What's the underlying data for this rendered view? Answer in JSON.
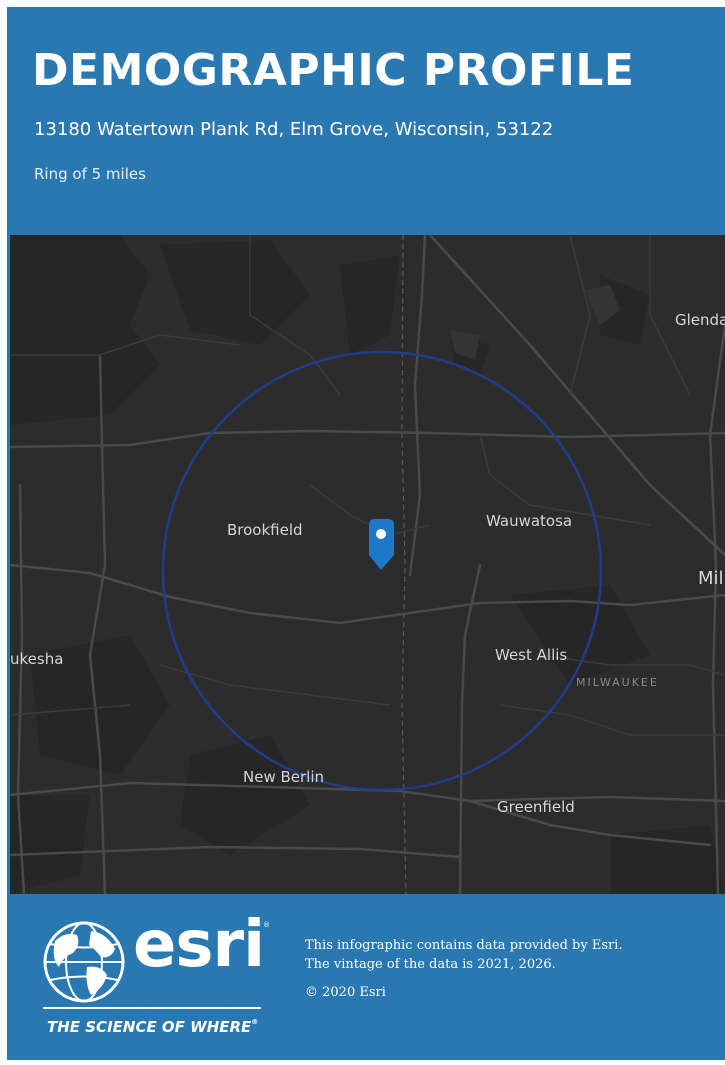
{
  "header": {
    "title": "DEMOGRAPHIC PROFILE",
    "address": "13180 Watertown Plank Rd, Elm Grove, Wisconsin, 53122",
    "ring": "Ring of 5 miles"
  },
  "map": {
    "labels": {
      "glendale": "Glendal",
      "brookfield": "Brookfield",
      "wauwatosa": "Wauwatosa",
      "milwaukee_city": "Mil",
      "waukesha": "ukesha",
      "west_allis": "West Allis",
      "milwaukee_county": "MILWAUKEE",
      "new_berlin": "New Berlin",
      "greenfield": "Greenfield"
    },
    "colors": {
      "background": "#2c2c2c",
      "ring": "#1f3d8a",
      "pin": "#1d78c9"
    }
  },
  "footer": {
    "logo_text": "esri",
    "tagline": "THE SCIENCE OF WHERE",
    "tagline_mark": "®",
    "logo_mark": "®",
    "notice_line1": "This infographic contains data provided by Esri.",
    "notice_line2": "The vintage of the data is 2021, 2026.",
    "copyright": "© 2020 Esri"
  },
  "colors": {
    "page_background": "#2a78b2",
    "text": "#ffffff"
  }
}
